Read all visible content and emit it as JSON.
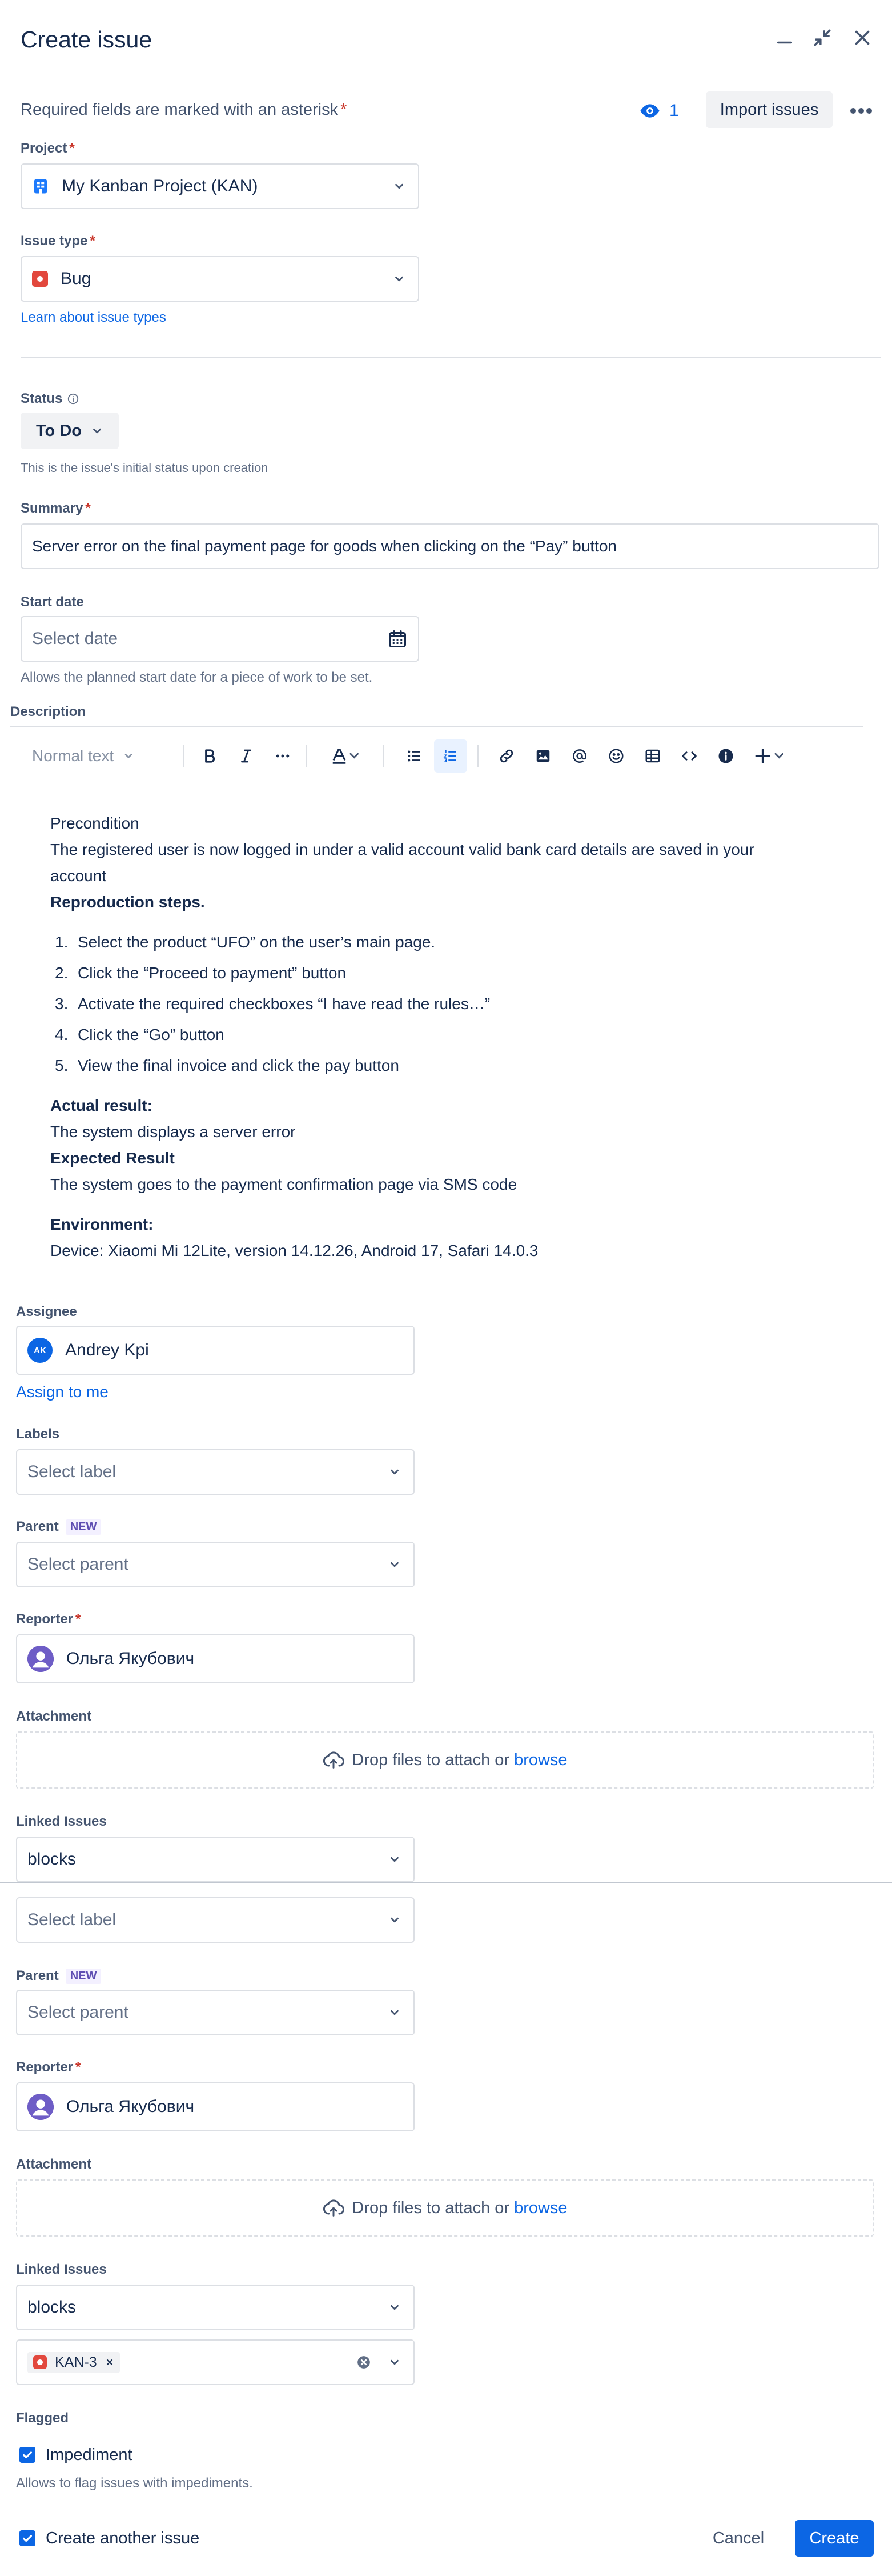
{
  "header": {
    "title": "Create issue",
    "required_note": "Required fields are marked with an asterisk",
    "asterisk": "*",
    "watch_count": "1",
    "import_label": "Import issues"
  },
  "project": {
    "label": "Project",
    "value": "My Kanban Project (KAN)"
  },
  "issue_type": {
    "label": "Issue type",
    "value": "Bug",
    "learn_link": "Learn about issue types"
  },
  "status": {
    "label": "Status",
    "value": "To Do",
    "help": "This is the issue's initial status upon creation"
  },
  "summary": {
    "label": "Summary",
    "value": "Server error on the final payment page for goods when clicking on the “Pay” button"
  },
  "start_date": {
    "label": "Start date",
    "placeholder": "Select date",
    "help": "Allows the planned start date for a piece of work to be set."
  },
  "description": {
    "label": "Description",
    "toolbar": {
      "text_style": "Normal text"
    },
    "precondition_title": "Precondition",
    "precondition_line1": "The registered user is now logged in under a valid account valid bank card details are saved in your",
    "precondition_line2": "account",
    "steps_title": "Reproduction steps.",
    "steps": [
      "Select the product “UFO” on the user’s main page.",
      "Click the “Proceed to payment” button",
      "Activate the required checkboxes “I have read the rules…”",
      "Click the “Go” button",
      "View the final invoice and click the pay button"
    ],
    "actual_title": "Actual result:",
    "actual_text": "The system displays a server error",
    "expected_title": "Expected Result",
    "expected_text": "The system goes to the payment confirmation page via SMS code",
    "env_title": "Environment:",
    "env_text": "Device: Xiaomi Mi 12Lite, version 14.12.26, Android 17, Safari 14.0.3"
  },
  "assignee": {
    "label": "Assignee",
    "initials": "AK",
    "value": "Andrey Kpi",
    "assign_to_me": "Assign to me"
  },
  "labels": {
    "label": "Labels",
    "placeholder": "Select label"
  },
  "parent": {
    "label": "Parent",
    "badge": "NEW",
    "placeholder": "Select parent"
  },
  "reporter": {
    "label": "Reporter",
    "value": "Ольга Якубович"
  },
  "attachment": {
    "label": "Attachment",
    "drop_text": "Drop files to attach or",
    "browse": "browse"
  },
  "linked_issues": {
    "label": "Linked Issues",
    "relation": "blocks",
    "issue_key": "KAN-3"
  },
  "flagged": {
    "label": "Flagged",
    "option": "Impediment",
    "help": "Allows to flag issues with impediments."
  },
  "footer": {
    "create_another": "Create another issue",
    "cancel": "Cancel",
    "create": "Create"
  },
  "colors": {
    "accent": "#0c66e4",
    "required": "#c9372c",
    "bug": "#e2483d",
    "text": "#172b4d"
  }
}
